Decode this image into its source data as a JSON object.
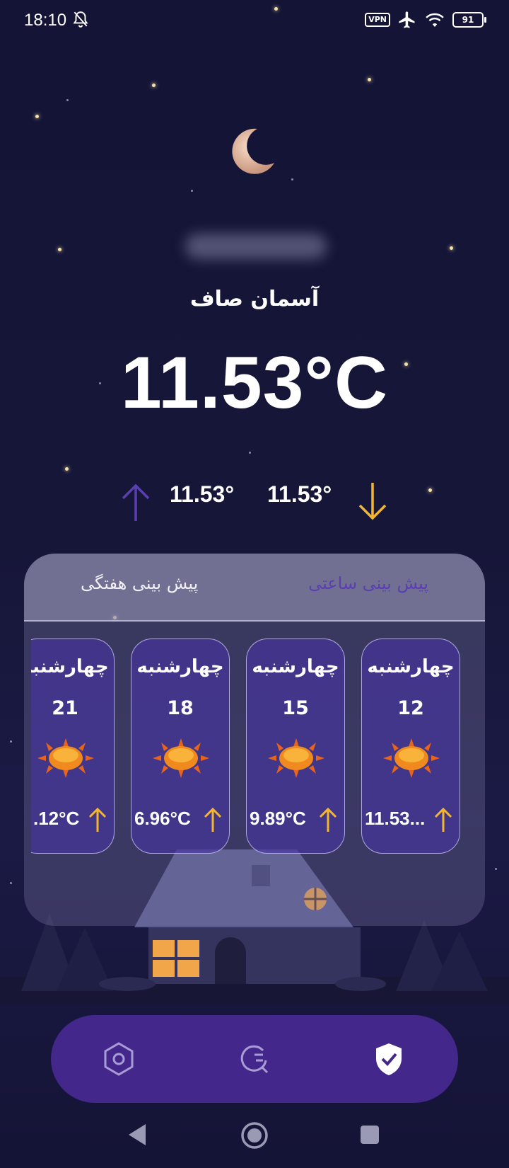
{
  "status_bar": {
    "time": "18:10",
    "vpn_label": "VPN",
    "battery": "91"
  },
  "weather": {
    "condition": "آسمان صاف",
    "temperature": "11.53°C",
    "max_temp": "11.53°",
    "min_temp": "11.53°"
  },
  "tabs": {
    "hourly": "پیش بینی ساعتی",
    "weekly": "پیش بینی هفتگی",
    "active": "hourly"
  },
  "forecast_cards": [
    {
      "day": "چهارشنبه",
      "date": "12",
      "temp": "11.53..."
    },
    {
      "day": "چهارشنبه",
      "date": "15",
      "temp": "9.89°C"
    },
    {
      "day": "چهارشنبه",
      "date": "18",
      "temp": "6.96°C"
    },
    {
      "day": "چهارشنبه",
      "date": "21",
      "temp": ".12°C"
    }
  ],
  "colors": {
    "background": "#141437",
    "accent_purple": "#43278a",
    "arrow_yellow": "#f2b630",
    "arrow_purple": "#5c3fae"
  },
  "icons": {
    "nav": [
      "settings-hexagon-icon",
      "search-icon",
      "shield-check-icon"
    ],
    "system": [
      "back-icon",
      "home-icon",
      "recents-icon"
    ]
  }
}
